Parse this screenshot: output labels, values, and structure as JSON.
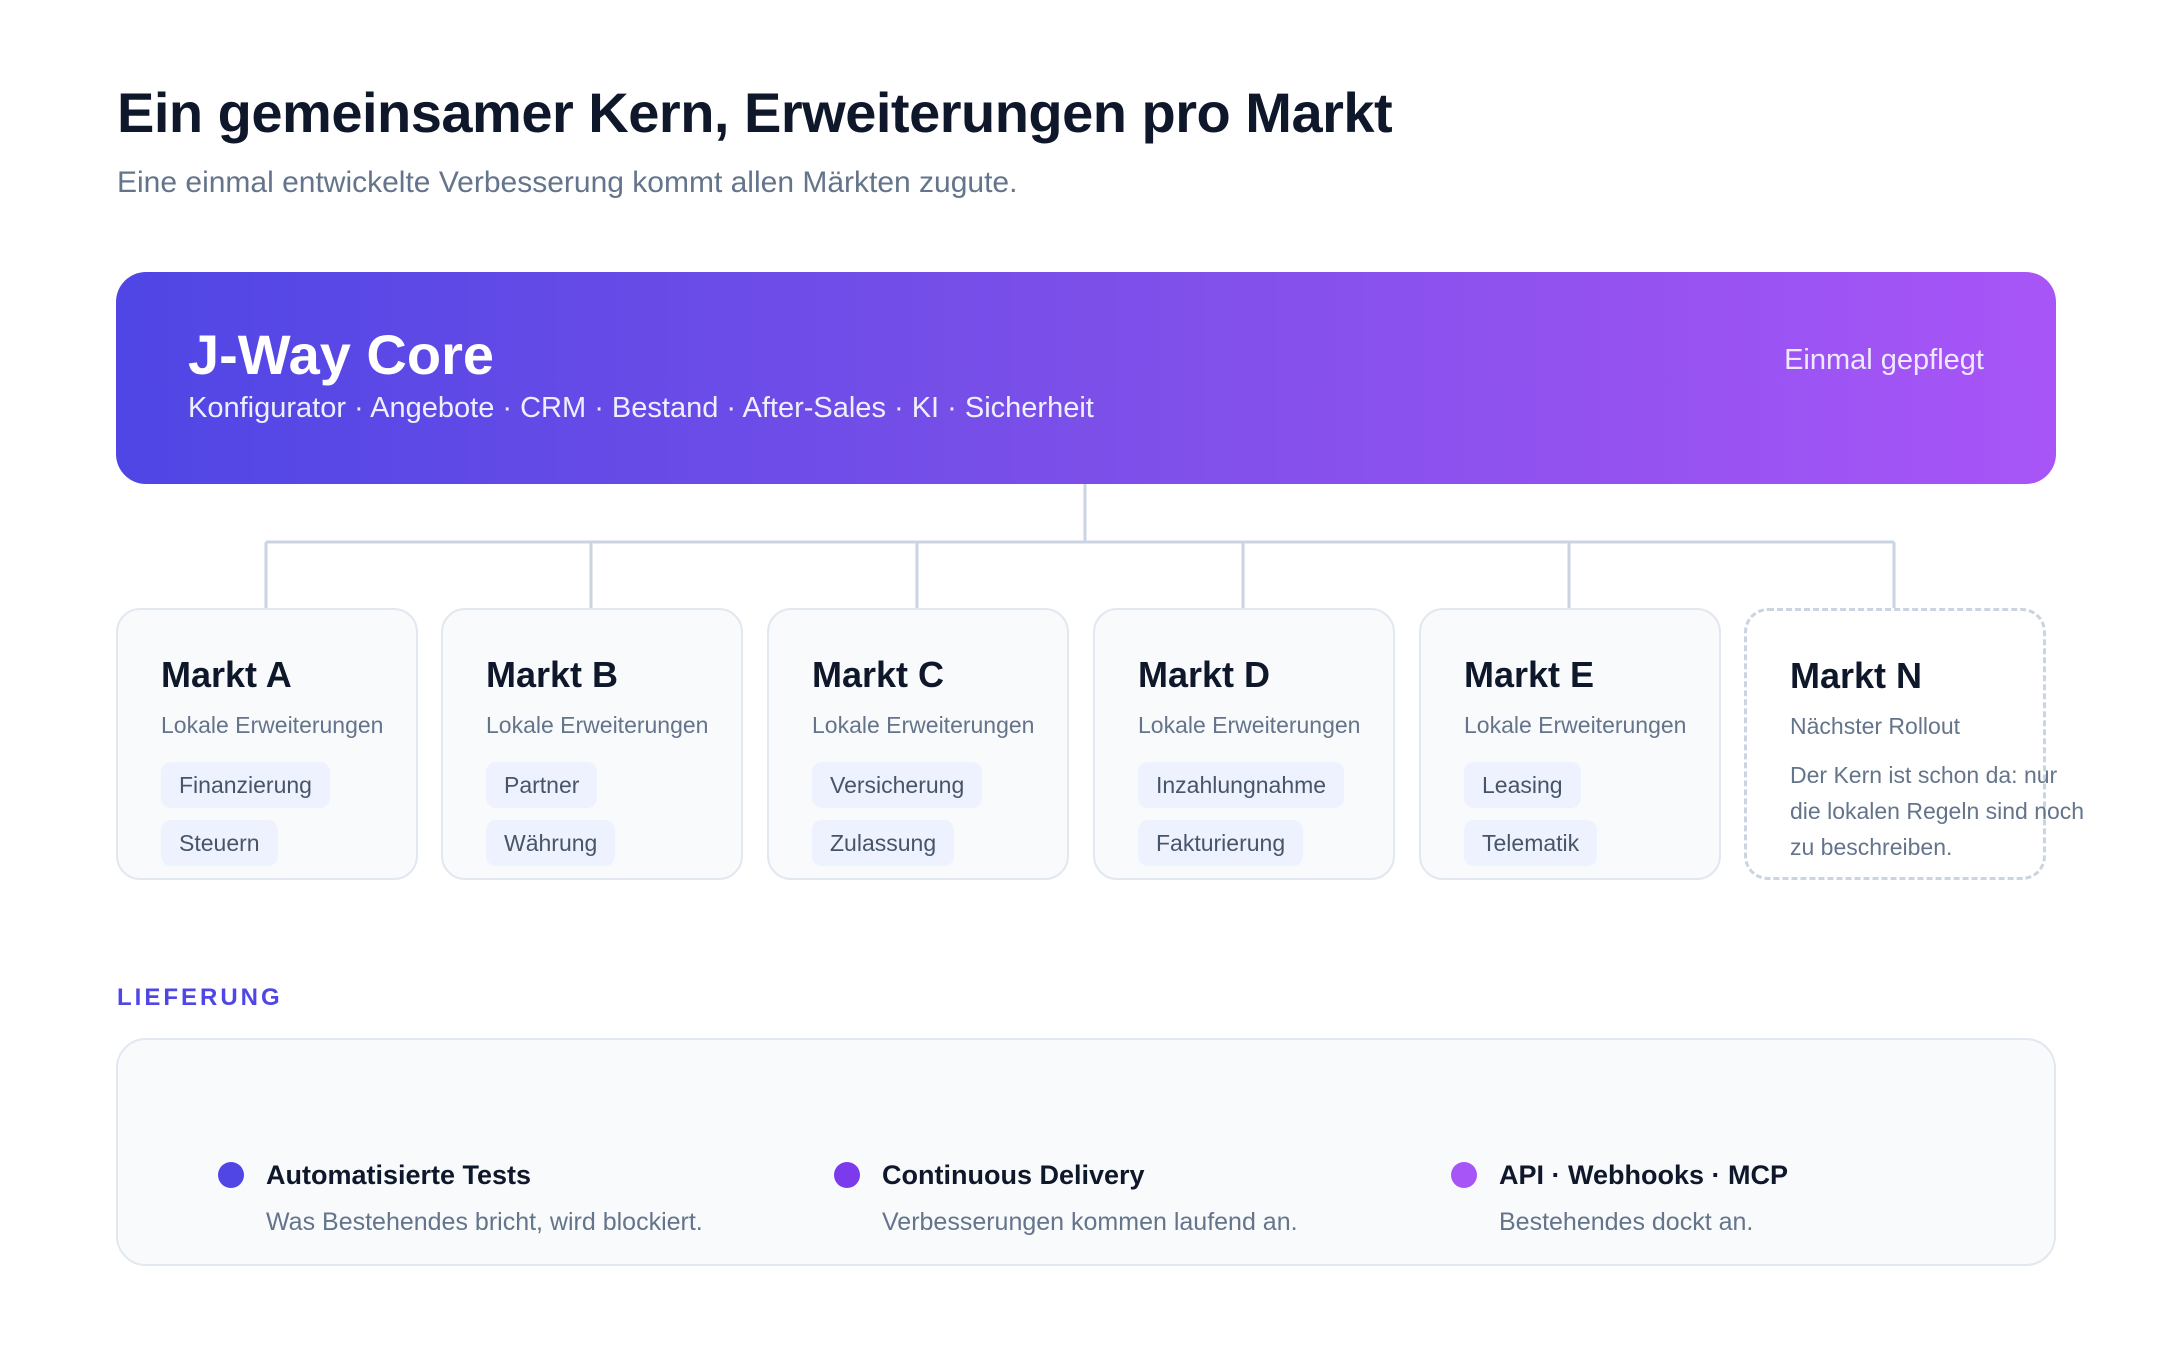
{
  "header": {
    "title": "Ein gemeinsamer Kern, Erweiterungen pro Markt",
    "subtitle": "Eine einmal entwickelte Verbesserung kommt allen Märkten zugute."
  },
  "core": {
    "title": "J-Way Core",
    "modules": "Konfigurator · Angebote · CRM · Bestand · After-Sales · KI · Sicherheit",
    "badge": "Einmal gepflegt"
  },
  "markets": [
    {
      "title": "Markt A",
      "subtitle": "Lokale Erweiterungen",
      "chips": [
        "Finanzierung",
        "Steuern"
      ]
    },
    {
      "title": "Markt B",
      "subtitle": "Lokale Erweiterungen",
      "chips": [
        "Partner",
        "Währung"
      ]
    },
    {
      "title": "Markt C",
      "subtitle": "Lokale Erweiterungen",
      "chips": [
        "Versicherung",
        "Zulassung"
      ]
    },
    {
      "title": "Markt D",
      "subtitle": "Lokale Erweiterungen",
      "chips": [
        "Inzahlungnahme",
        "Fakturierung"
      ]
    },
    {
      "title": "Markt E",
      "subtitle": "Lokale Erweiterungen",
      "chips": [
        "Leasing",
        "Telematik"
      ]
    },
    {
      "title": "Markt N",
      "subtitle": "Nächster Rollout",
      "note": "Der Kern ist schon da: nur die lokalen Regeln sind noch zu beschreiben."
    }
  ],
  "delivery": {
    "label": "LIEFERUNG",
    "items": [
      {
        "title": "Automatisierte Tests",
        "description": "Was Bestehendes bricht, wird blockiert.",
        "color": "#4f46e5"
      },
      {
        "title": "Continuous Delivery",
        "description": "Verbesserungen kommen laufend an.",
        "color": "#7c3aed"
      },
      {
        "title": "API · Webhooks · MCP",
        "description": "Bestehendes dockt an.",
        "color": "#a855f7"
      }
    ]
  },
  "colors": {
    "core_gradient_start": "#4f46e5",
    "core_gradient_end": "#a855f7",
    "connector": "#cbd5e1",
    "accent": "#4f46e5"
  }
}
